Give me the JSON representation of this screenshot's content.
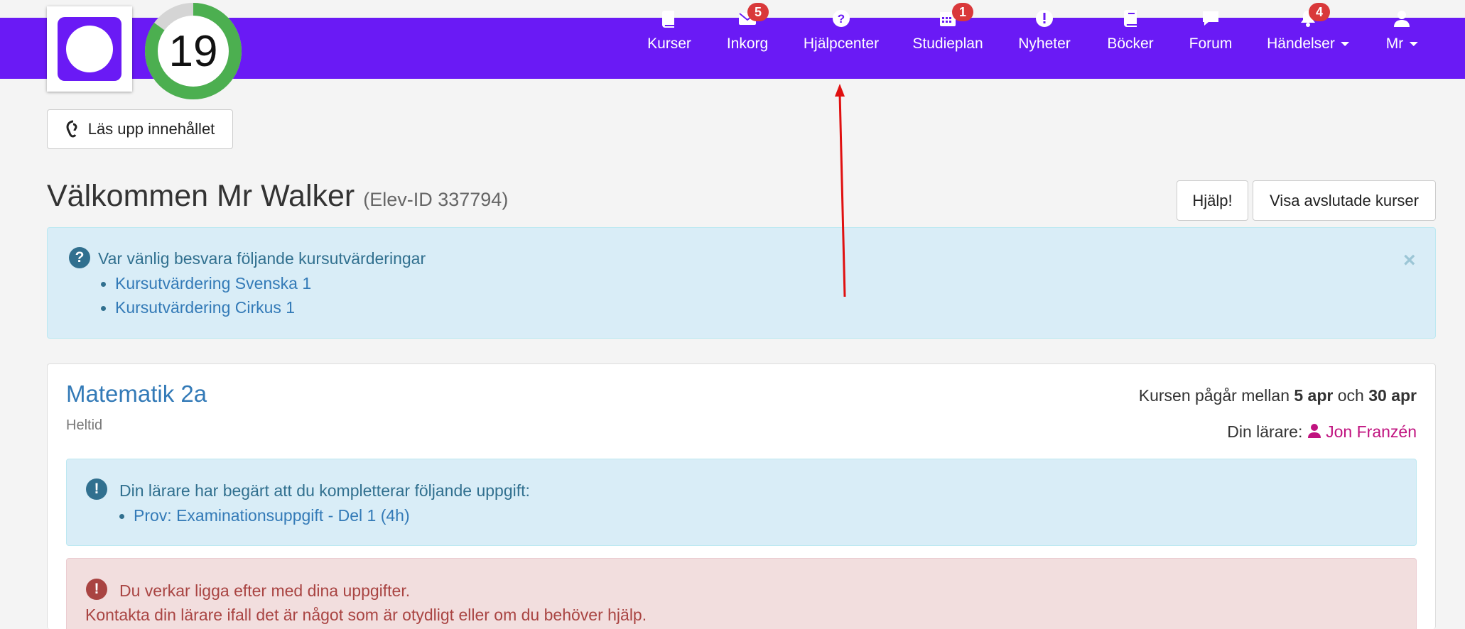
{
  "header": {
    "streak_count": "19",
    "nav": [
      {
        "id": "kurser",
        "label": "Kurser",
        "icon": "book-icon",
        "badge": null,
        "caret": false
      },
      {
        "id": "inkorg",
        "label": "Inkorg",
        "icon": "envelope-icon",
        "badge": "5",
        "caret": false
      },
      {
        "id": "hjalpcenter",
        "label": "Hjälpcenter",
        "icon": "question-circle-icon",
        "badge": null,
        "caret": false
      },
      {
        "id": "studieplan",
        "label": "Studieplan",
        "icon": "calendar-icon",
        "badge": "1",
        "caret": false
      },
      {
        "id": "nyheter",
        "label": "Nyheter",
        "icon": "exclamation-circle-icon",
        "badge": null,
        "caret": false
      },
      {
        "id": "bocker",
        "label": "Böcker",
        "icon": "books-icon",
        "badge": null,
        "caret": false
      },
      {
        "id": "forum",
        "label": "Forum",
        "icon": "comment-icon",
        "badge": null,
        "caret": false
      },
      {
        "id": "handelser",
        "label": "Händelser",
        "icon": "bell-icon",
        "badge": "4",
        "caret": true
      },
      {
        "id": "user",
        "label": "Mr",
        "icon": "user-icon",
        "badge": null,
        "caret": true
      }
    ]
  },
  "read_aloud_label": "Läs upp innehållet",
  "welcome": {
    "title": "Välkommen Mr Walker",
    "student_id": "(Elev-ID 337794)"
  },
  "buttons": {
    "help": "Hjälp!",
    "show_finished": "Visa avslutade kurser"
  },
  "evaluation_alert": {
    "heading": "Var vänlig besvara följande kursutvärderingar",
    "items": [
      "Kursutvärdering Svenska 1",
      "Kursutvärdering Cirkus 1"
    ],
    "close": "×"
  },
  "course": {
    "title": "Matematik 2a",
    "pace": "Heltid",
    "period_prefix": "Kursen pågår mellan",
    "start": "5 apr",
    "period_mid": "och",
    "end": "30 apr",
    "teacher_label": "Din lärare:",
    "teacher_name": "Jon Franzén",
    "complete_alert": {
      "heading": "Din lärare har begärt att du kompletterar följande uppgift:",
      "items": [
        "Prov: Examinationsuppgift - Del 1 (4h)"
      ]
    },
    "behind_alert": {
      "line1": "Du verkar ligga efter med dina uppgifter.",
      "line2": "Kontakta din lärare ifall det är något som är otydligt eller om du behöver hjälp."
    }
  },
  "colors": {
    "brand": "#6a1af5",
    "streak_ring": "#4caf50",
    "badge": "#d9383a",
    "link": "#337ab7",
    "teacher": "#c0127f"
  }
}
